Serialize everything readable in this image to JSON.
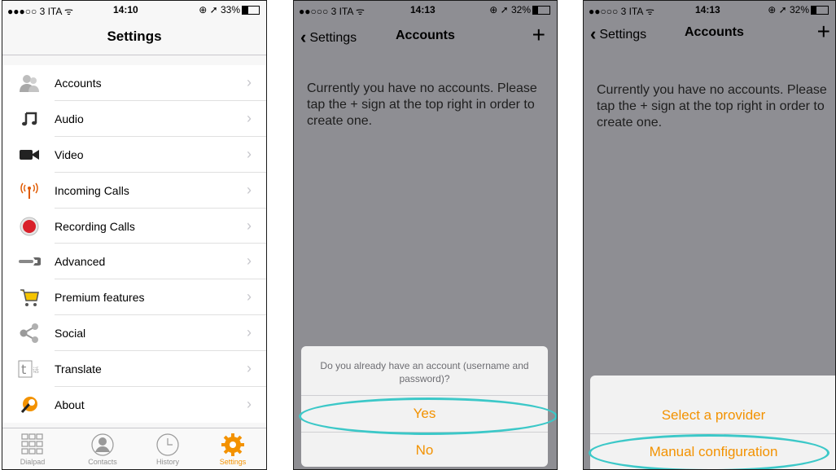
{
  "panel1": {
    "status": {
      "carrier": "●●●○○ 3 ITA ᯤ",
      "time": "14:10",
      "battery": "⊕ ➚ 33%",
      "battery_level": 0.33
    },
    "title": "Settings",
    "items": [
      {
        "label": "Accounts",
        "icon": "accounts-icon"
      },
      {
        "label": "Audio",
        "icon": "music-note-icon"
      },
      {
        "label": "Video",
        "icon": "video-camera-icon"
      },
      {
        "label": "Incoming Calls",
        "icon": "antenna-icon"
      },
      {
        "label": "Recording Calls",
        "icon": "record-icon"
      },
      {
        "label": "Advanced",
        "icon": "wrench-icon"
      },
      {
        "label": "Premium features",
        "icon": "cart-icon"
      },
      {
        "label": "Social",
        "icon": "share-icon"
      },
      {
        "label": "Translate",
        "icon": "translate-icon"
      },
      {
        "label": "About",
        "icon": "about-icon"
      }
    ],
    "chevron": "›",
    "tabs": [
      {
        "label": "Dialpad",
        "icon": "dialpad-icon",
        "active": false
      },
      {
        "label": "Contacts",
        "icon": "contacts-icon",
        "active": false
      },
      {
        "label": "History",
        "icon": "clock-icon",
        "active": false
      },
      {
        "label": "Settings",
        "icon": "gear-icon",
        "active": true
      }
    ]
  },
  "panel2": {
    "status": {
      "carrier": "●●○○○ 3 ITA ᯤ",
      "time": "14:13",
      "battery": "⊕ ➚ 32%",
      "battery_level": 0.32
    },
    "back_label": "Settings",
    "title": "Accounts",
    "add": "+",
    "message": "Currently you have no accounts. Please tap the + sign at the top right in order to create one.",
    "sheet": {
      "question": "Do you already have an account (username and password)?",
      "yes": "Yes",
      "no": "No"
    }
  },
  "panel3": {
    "status": {
      "carrier": "●●○○○ 3 ITA ᯤ",
      "time": "14:13",
      "battery": "⊕ ➚ 32%",
      "battery_level": 0.32
    },
    "back_label": "Settings",
    "title": "Accounts",
    "add": "+",
    "message": "Currently you have no accounts. Please tap the + sign at the top right in order to create one.",
    "sheet": {
      "select_provider": "Select a provider",
      "manual": "Manual configuration"
    }
  },
  "colors": {
    "accent": "#f39200",
    "highlight": "#3cc8c8",
    "overlay": "#8e8e93"
  }
}
